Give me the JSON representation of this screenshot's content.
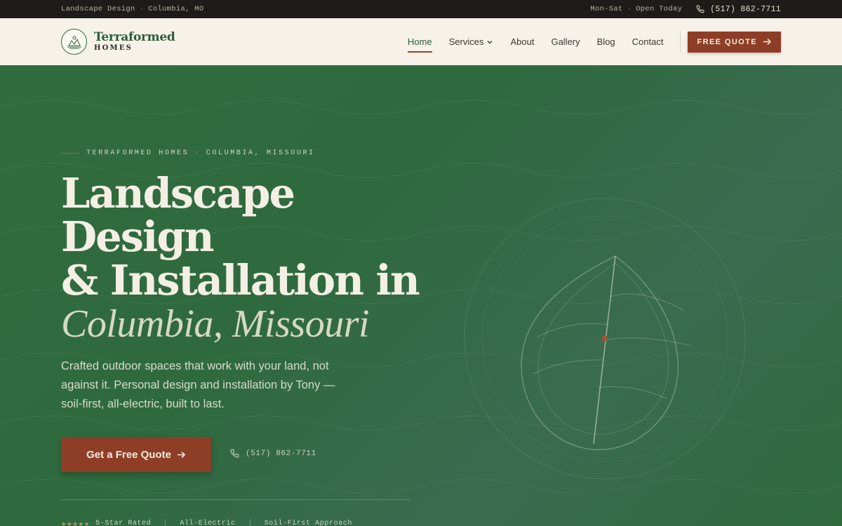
{
  "topbar": {
    "left_service": "Landscape Design",
    "left_location": "Columbia, MO",
    "hours": "Mon-Sat",
    "status": "Open Today",
    "phone": "(517) 862-7711"
  },
  "header": {
    "logo_name": "Terraformed",
    "logo_sub": "HOMES",
    "nav": [
      {
        "label": "Home",
        "active": true
      },
      {
        "label": "Services"
      },
      {
        "label": "About"
      },
      {
        "label": "Gallery"
      },
      {
        "label": "Blog"
      },
      {
        "label": "Contact"
      }
    ],
    "quote_label": "FREE QUOTE"
  },
  "hero": {
    "eyebrow_brand": "TERRAFORMED HOMES",
    "eyebrow_location": "COLUMBIA, MISSOURI",
    "headline_line1": "Landscape",
    "headline_line2": "Design",
    "headline_line3": "& Installation in",
    "headline_italic": "Columbia, Missouri",
    "lede": "Crafted outdoor spaces that work with your land, not against it. Personal design and installation by Tony — soil-first, all-electric, built to last.",
    "cta_label": "Get a Free Quote",
    "phone": "(517) 862-7711",
    "badges": {
      "stars": "★★★★★",
      "rating": "5-Star Rated",
      "electric": "All-Electric",
      "soil": "Soil-First Approach"
    }
  },
  "colors": {
    "brand_green": "#2b5e36",
    "accent_rust": "#8e3e26",
    "cream": "#f6f1e9",
    "dark": "#1d1c18"
  },
  "icons": [
    "phone-icon",
    "chevron-down-icon",
    "arrow-right-icon",
    "star-icon",
    "logo-icon",
    "leaf-illustration"
  ]
}
